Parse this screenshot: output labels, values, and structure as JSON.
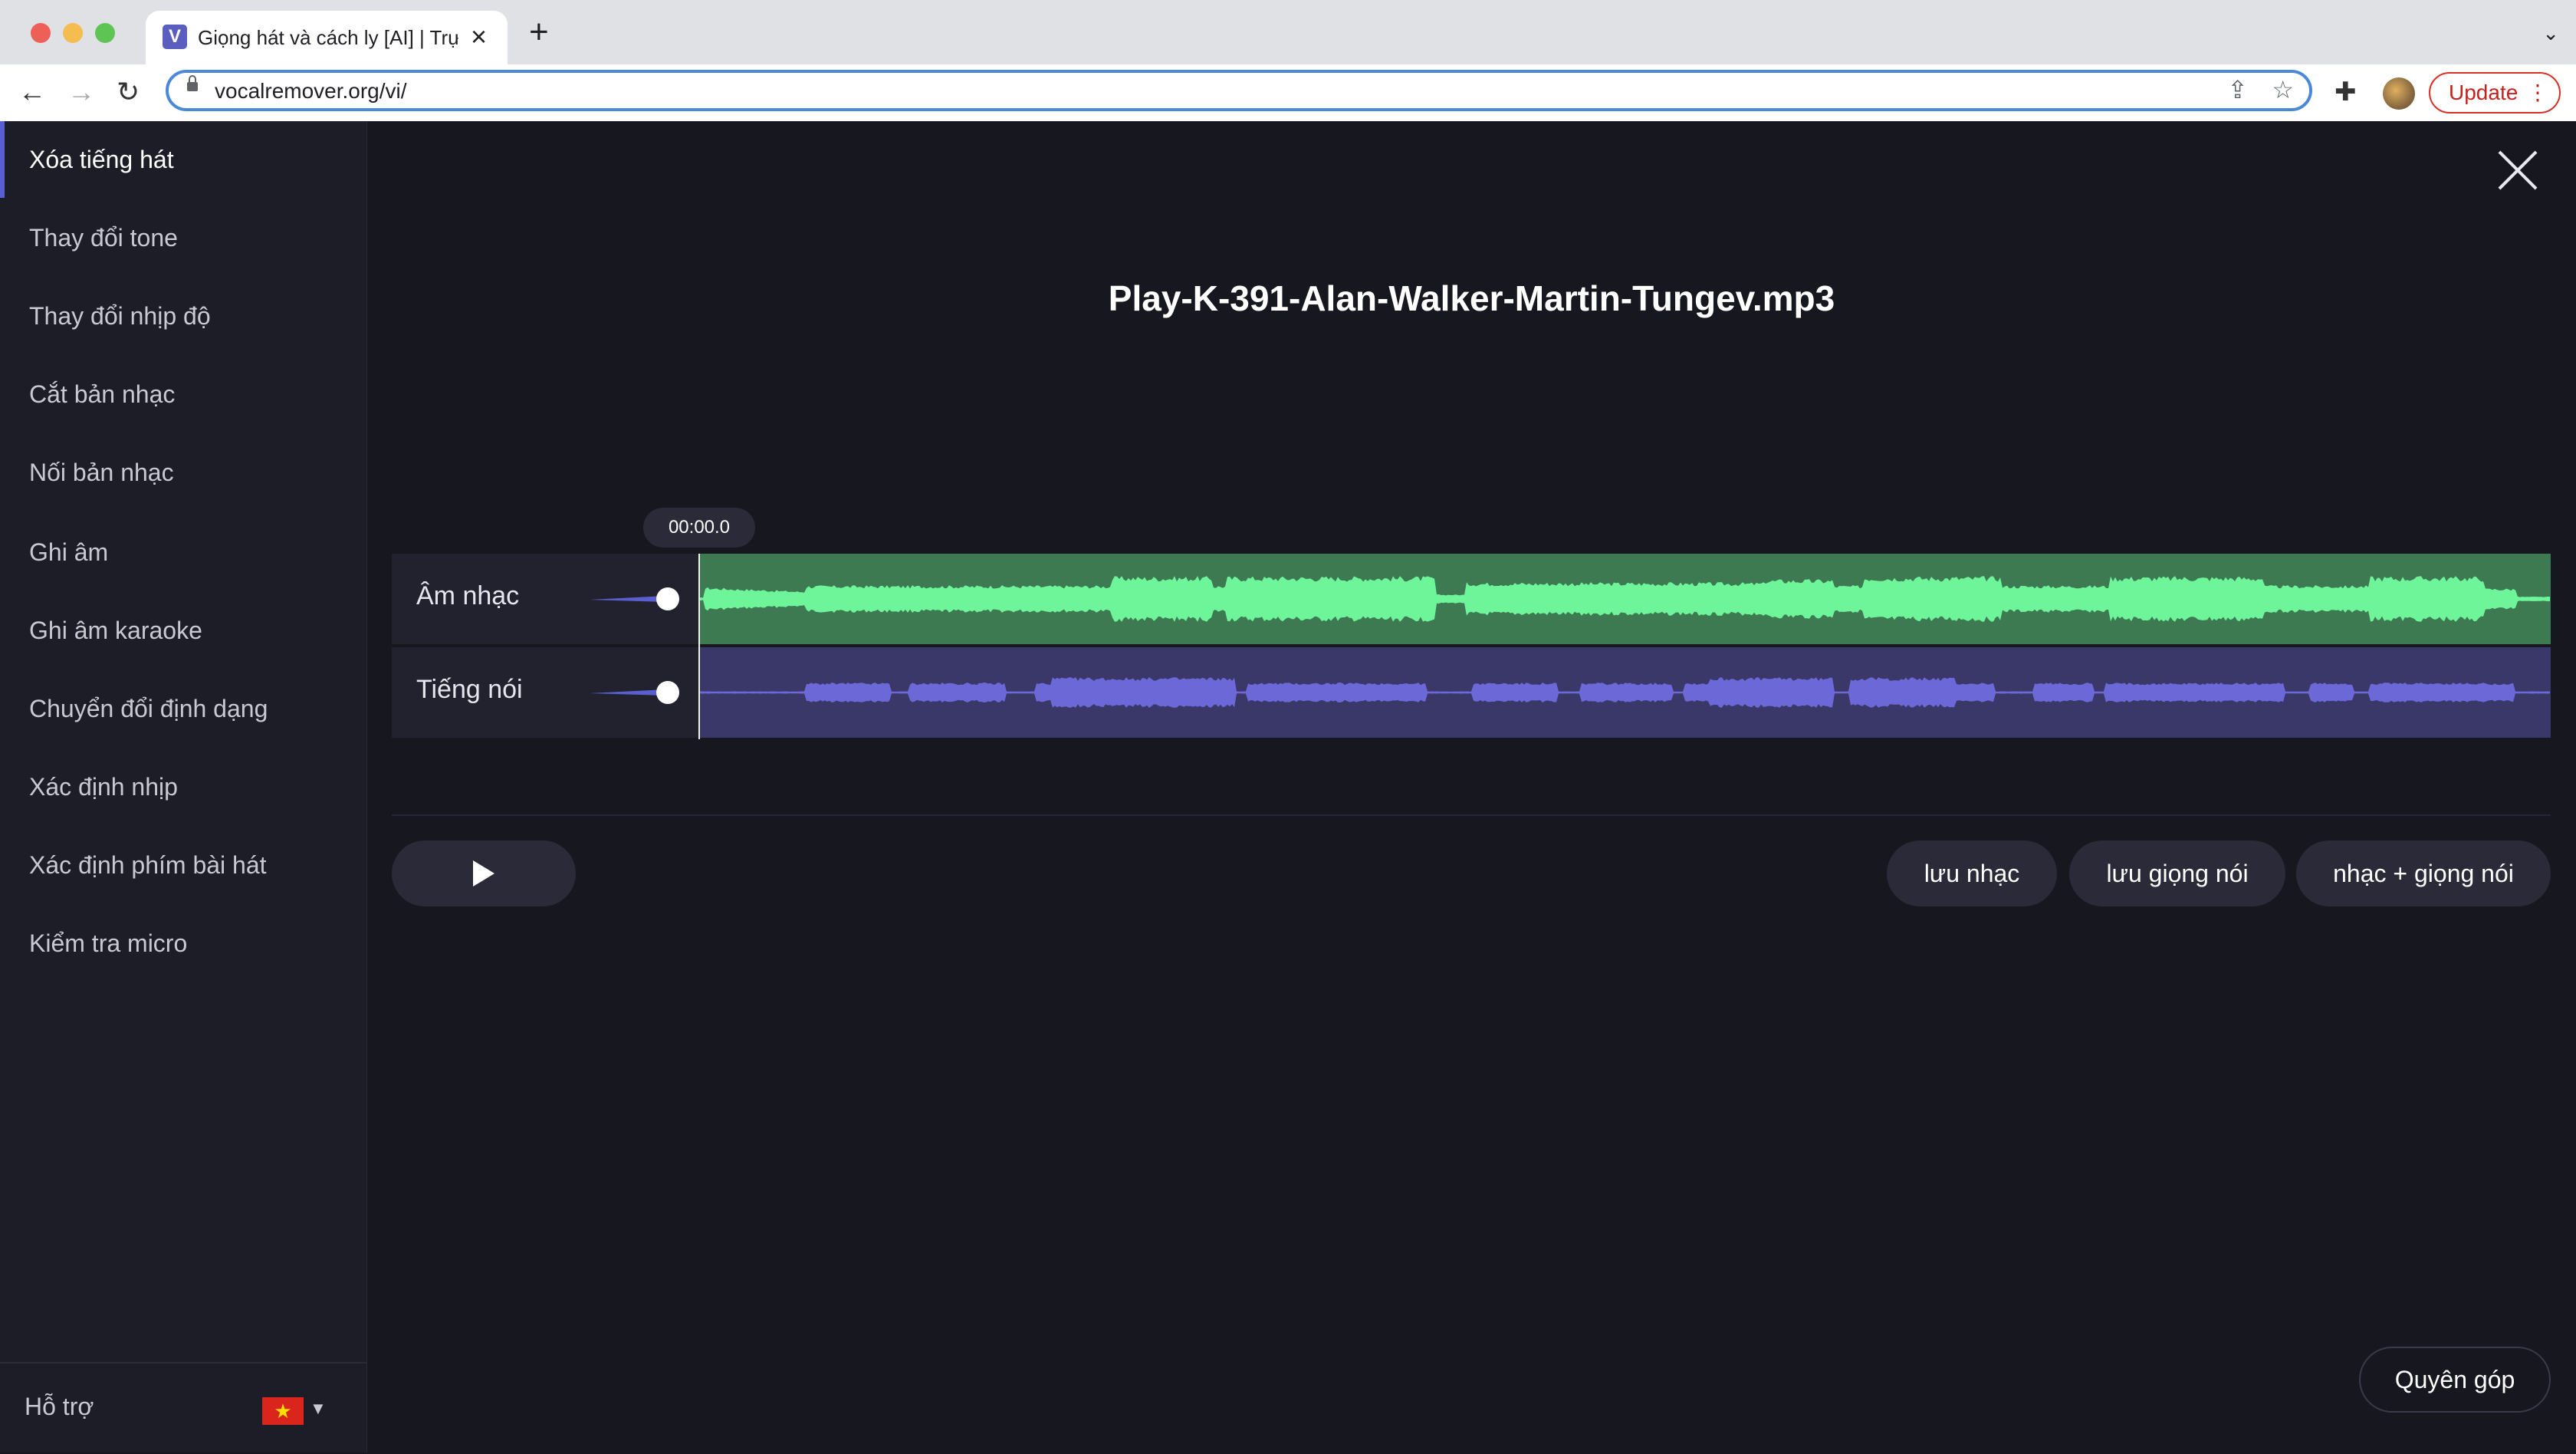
{
  "browser": {
    "tab_title": "Giọng hát và cách ly [AI] | Trực",
    "favicon_letter": "V",
    "url": "vocalremover.org/vi/",
    "update_label": "Update"
  },
  "sidebar": {
    "items": [
      {
        "label": "Xóa tiếng hát",
        "active": true
      },
      {
        "label": "Thay đổi tone"
      },
      {
        "label": "Thay đổi nhịp độ"
      },
      {
        "label": "Cắt bản nhạc"
      },
      {
        "label": "Nối bản nhạc"
      },
      {
        "label": "Ghi âm"
      },
      {
        "label": "Ghi âm karaoke"
      },
      {
        "label": "Chuyển đổi định dạng"
      },
      {
        "label": "Xác định nhịp"
      },
      {
        "label": "Xác định phím bài hát"
      },
      {
        "label": "Kiểm tra micro"
      }
    ],
    "support_label": "Hỗ trợ"
  },
  "player": {
    "file_name": "Play-K-391-Alan-Walker-Martin-Tungev.mp3",
    "current_time": "00:00.0",
    "tracks": [
      {
        "name": "Âm nhạc",
        "volume": 1.0,
        "wave_color": "#6ef59a"
      },
      {
        "name": "Tiếng nói",
        "volume": 1.0,
        "wave_color": "#6c68d8"
      }
    ],
    "buttons": {
      "save_music": "lưu nhạc",
      "save_vocal": "lưu giọng nói",
      "music_plus_vocal": "nhạc + giọng nói"
    },
    "donate_label": "Quyên góp"
  },
  "colors": {
    "accent": "#5a5fcf",
    "music_track_bg": "#3d7a52",
    "vocal_track_bg": "#3a3868",
    "background": "#17171f"
  }
}
